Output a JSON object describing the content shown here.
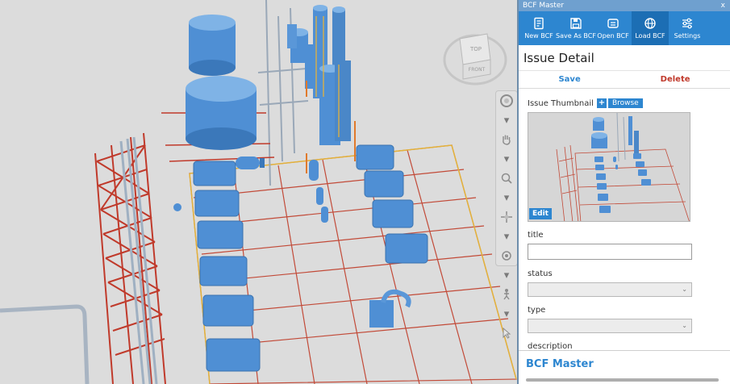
{
  "panel": {
    "window_title": "BCF Master",
    "close_glyph": "x",
    "toolbar": [
      {
        "label": "New BCF",
        "icon": "new-bcf-icon"
      },
      {
        "label": "Save As BCF",
        "icon": "save-icon"
      },
      {
        "label": "Open BCF",
        "icon": "open-bcf-icon"
      },
      {
        "label": "Load BCF",
        "icon": "globe-icon"
      },
      {
        "label": "Settings",
        "icon": "sliders-icon"
      }
    ],
    "heading": "Issue Detail",
    "save_label": "Save",
    "delete_label": "Delete",
    "thumbnail_label": "Issue Thumbnail",
    "plus_label": "+",
    "browse_label": "Browse",
    "edit_label": "Edit",
    "title_label": "title",
    "status_label": "status",
    "type_label": "type",
    "description_label": "description",
    "footer_brand": "BCF Master"
  },
  "viewcube": {
    "top": "TOP",
    "front": "FRONT"
  },
  "colors": {
    "accent": "#2d86d0",
    "delete": "#c0392b",
    "vessel": "#4f8fd4",
    "steel": "#c03a2b"
  }
}
